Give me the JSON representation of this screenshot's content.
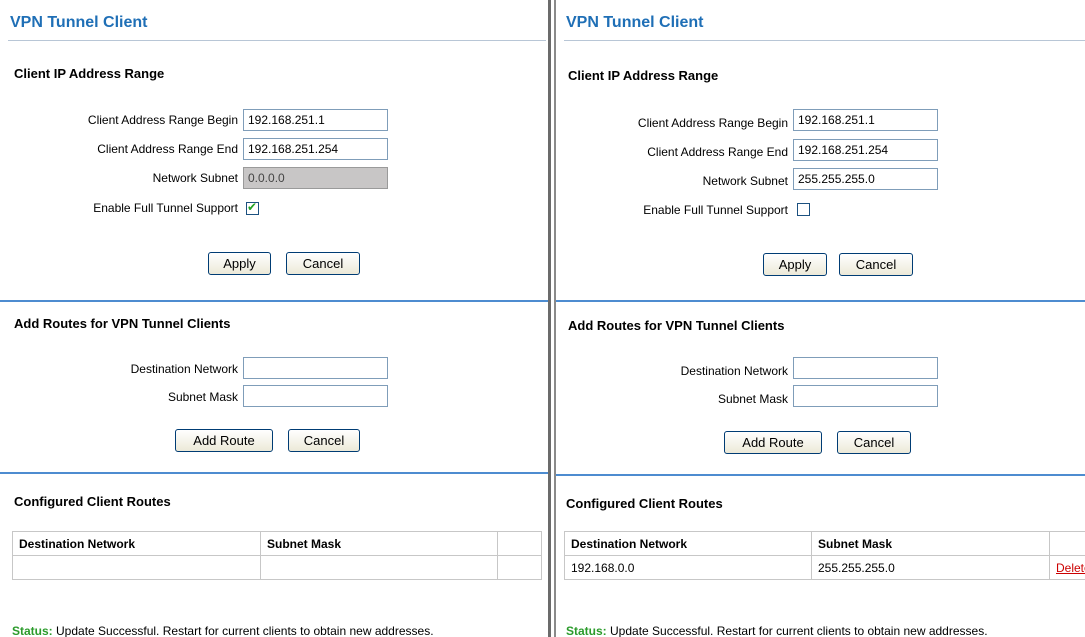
{
  "left": {
    "title": "VPN Tunnel Client",
    "client_range": {
      "heading": "Client IP Address Range",
      "begin_label": "Client Address Range Begin",
      "begin_value": "192.168.251.1",
      "end_label": "Client Address Range End",
      "end_value": "192.168.251.254",
      "subnet_label": "Network Subnet",
      "subnet_value": "0.0.0.0",
      "full_tunnel_label": "Enable Full Tunnel Support",
      "full_tunnel_checked": true,
      "checkmark": "✔",
      "apply": "Apply",
      "cancel": "Cancel"
    },
    "add_routes": {
      "heading": "Add Routes for VPN Tunnel Clients",
      "dest_label": "Destination Network",
      "dest_value": "",
      "mask_label": "Subnet Mask",
      "mask_value": "",
      "add": "Add Route",
      "cancel": "Cancel"
    },
    "configured": {
      "heading": "Configured Client Routes",
      "columns": [
        "Destination Network",
        "Subnet Mask",
        ""
      ],
      "rows": [
        [
          "",
          "",
          ""
        ]
      ]
    },
    "status_label": "Status:",
    "status_text": " Update Successful. Restart for current clients to obtain new addresses."
  },
  "right": {
    "title": "VPN Tunnel Client",
    "client_range": {
      "heading": "Client IP Address Range",
      "begin_label": "Client Address Range Begin",
      "begin_value": "192.168.251.1",
      "end_label": "Client Address Range End",
      "end_value": "192.168.251.254",
      "subnet_label": "Network Subnet",
      "subnet_value": "255.255.255.0",
      "full_tunnel_label": "Enable Full Tunnel Support",
      "full_tunnel_checked": false,
      "apply": "Apply",
      "cancel": "Cancel"
    },
    "add_routes": {
      "heading": "Add Routes for VPN Tunnel Clients",
      "dest_label": "Destination Network",
      "dest_value": "",
      "mask_label": "Subnet Mask",
      "mask_value": "",
      "add": "Add Route",
      "cancel": "Cancel"
    },
    "configured": {
      "heading": "Configured Client Routes",
      "columns": [
        "Destination Network",
        "Subnet Mask",
        ""
      ],
      "rows": [
        [
          "192.168.0.0",
          "255.255.255.0",
          "Delete"
        ]
      ]
    },
    "status_label": "Status:",
    "status_text": " Update Successful. Restart for current clients to obtain new addresses."
  }
}
